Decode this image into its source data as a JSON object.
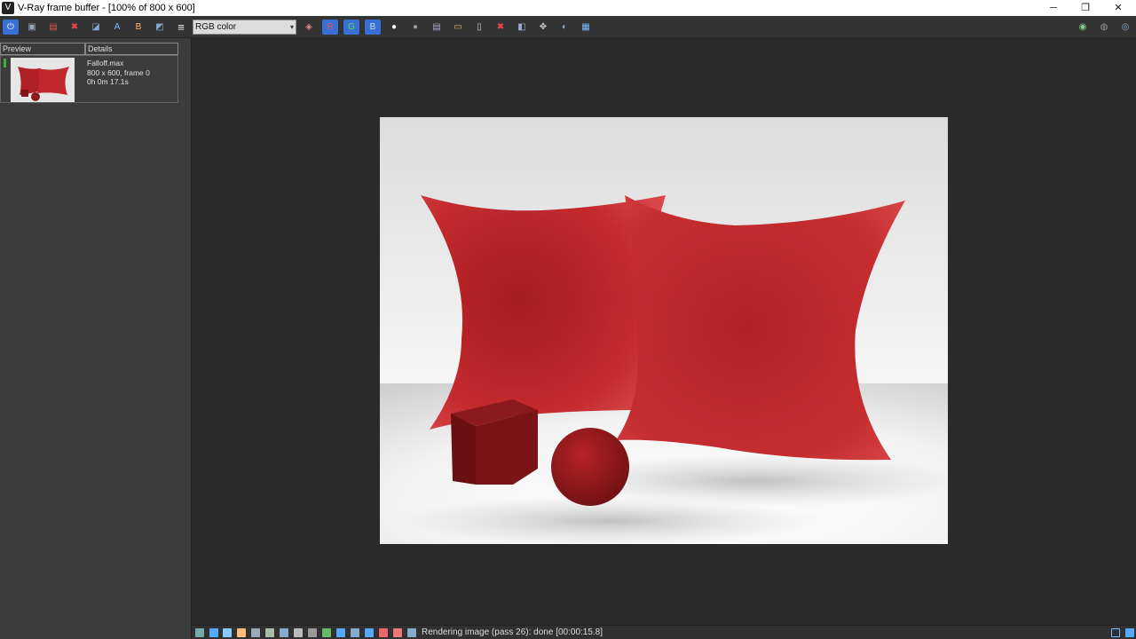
{
  "window": {
    "title": "V-Ray frame buffer - [100% of 800 x 600]",
    "icon_label": "V",
    "controls": [
      "minimize-icon",
      "restore-icon",
      "close-icon"
    ],
    "control_glyphs": [
      "─",
      "❐",
      "✕"
    ]
  },
  "toolbar": {
    "channel_select": {
      "value": "RGB color",
      "arrow": "▾"
    },
    "channel_buttons": [
      "R",
      "G",
      "B"
    ],
    "left_button_glyphs": [
      "⏻",
      "▣",
      "▤",
      "✖",
      "◪",
      "A",
      "B",
      "◩",
      "≡"
    ],
    "right_button_glyphs": [
      "◈",
      "●",
      "●",
      "▤",
      "▭",
      "▯",
      "✖",
      "◧",
      "✥",
      "◐",
      "▦"
    ],
    "far_right_glyphs": [
      "◉",
      "◍",
      "◎"
    ]
  },
  "history": {
    "columns": [
      "Preview",
      "Details"
    ],
    "items": [
      {
        "name": "Falloff.max",
        "resolution": "800 x 600, frame 0",
        "time": "0h 0m 17.1s"
      }
    ]
  },
  "status": {
    "text": "Rendering image (pass 26): done [00:00:15.8]"
  },
  "colors": {
    "accent": "#3a6fd8",
    "pillow_red": "#c0282c",
    "background": "#2a2a2a"
  }
}
